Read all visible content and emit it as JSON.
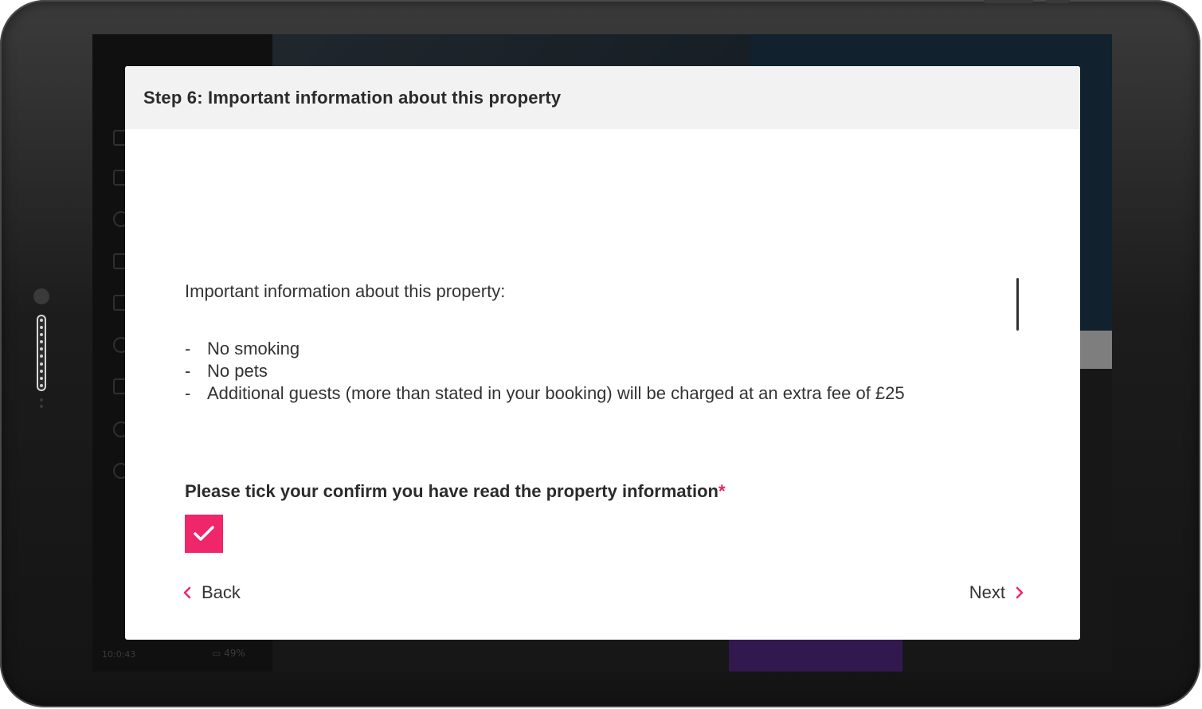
{
  "modal": {
    "title": "Step 6: Important information about this property",
    "intro": "Important information about this property:",
    "items": [
      "No smoking",
      "No pets",
      "Additional guests (more than stated in your booking) will be charged at an extra fee of £25"
    ],
    "confirm_label": "Please tick your confirm you have read the property information",
    "required_mark": "*",
    "checkbox_checked": true,
    "back_label": "Back",
    "next_label": "Next"
  },
  "background": {
    "status_time": "10:0:43",
    "battery": "49%"
  },
  "colors": {
    "accent": "#f0266b",
    "header_bg": "#f2f2f2",
    "text": "#333333"
  },
  "icons": {
    "back": "chevron-left-icon",
    "next": "chevron-right-icon",
    "checkbox": "checkmark-icon"
  }
}
